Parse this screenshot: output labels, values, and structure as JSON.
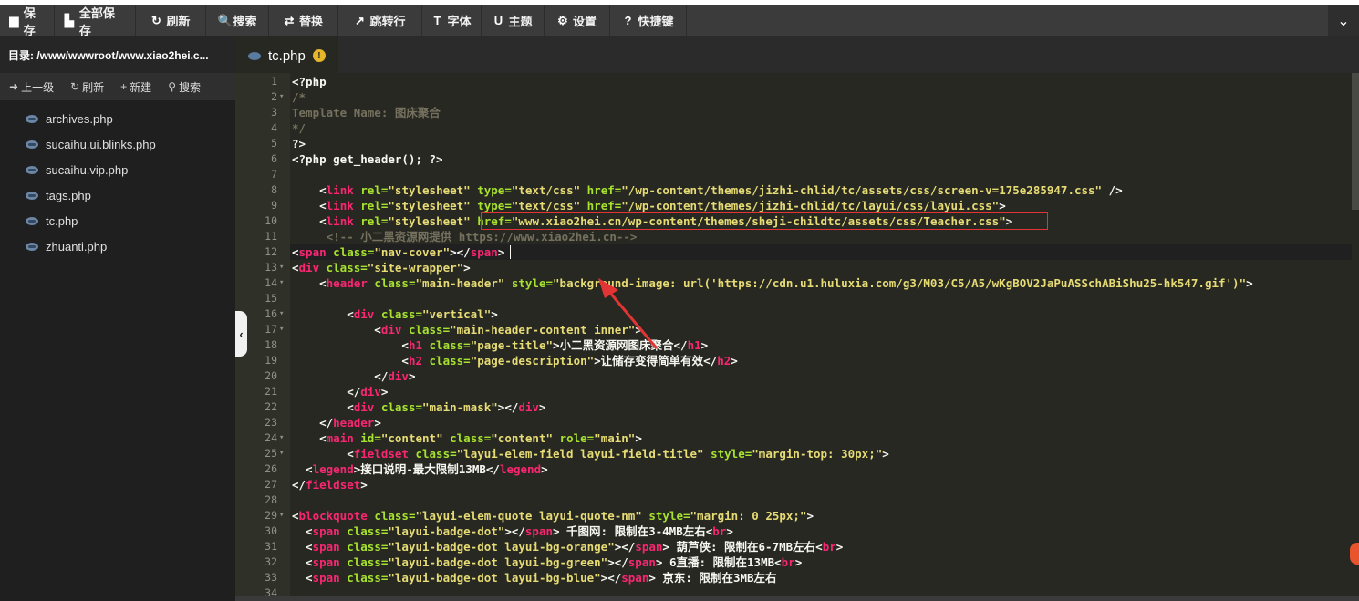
{
  "toolbar": {
    "buttons": [
      {
        "label": "保存",
        "icon": "floppy-disk-icon",
        "glyph": "▆"
      },
      {
        "label": "全部保存",
        "icon": "save-all-icon",
        "glyph": "▙"
      },
      {
        "label": "刷新",
        "icon": "refresh-icon",
        "glyph": "↻"
      },
      {
        "label": "搜索",
        "icon": "search-icon",
        "glyph": "🔍"
      },
      {
        "label": "替换",
        "icon": "replace-icon",
        "glyph": "⇄"
      },
      {
        "label": "跳转行",
        "icon": "goto-line-icon",
        "glyph": "↗"
      },
      {
        "label": "字体",
        "icon": "font-icon",
        "glyph": "T"
      },
      {
        "label": "主题",
        "icon": "theme-icon",
        "glyph": "U"
      },
      {
        "label": "设置",
        "icon": "gear-icon",
        "glyph": "⚙"
      },
      {
        "label": "快捷键",
        "icon": "help-icon",
        "glyph": "?"
      }
    ],
    "collapse_icon": "chevron-down-icon"
  },
  "sidebar": {
    "path": "目录: /www/wwwroot/www.xiao2hei.c...",
    "actions": [
      {
        "label": "上一级",
        "icon": "up-level-icon",
        "glyph": "➜"
      },
      {
        "label": "刷新",
        "icon": "refresh-icon",
        "glyph": "↻"
      },
      {
        "label": "新建",
        "icon": "plus-icon",
        "glyph": "+"
      },
      {
        "label": "搜索",
        "icon": "search-icon",
        "glyph": "⚲"
      }
    ],
    "files": [
      "archives.php",
      "sucaihu.ui.blinks.php",
      "sucaihu.vip.php",
      "tags.php",
      "tc.php",
      "zhuanti.php"
    ]
  },
  "editor": {
    "tab": {
      "label": "tc.php",
      "warning": "!"
    },
    "lines": [
      {
        "n": "1",
        "fold": "",
        "segs": [
          [
            "<?php",
            "#f8f8f2"
          ]
        ]
      },
      {
        "n": "2",
        "fold": "▾",
        "segs": [
          [
            "/*",
            "#75715e"
          ]
        ]
      },
      {
        "n": "3",
        "fold": "",
        "segs": [
          [
            "Template Name: 图床聚合",
            "#75715e"
          ]
        ]
      },
      {
        "n": "4",
        "fold": "",
        "segs": [
          [
            "*/",
            "#75715e"
          ]
        ]
      },
      {
        "n": "5",
        "fold": "",
        "segs": [
          [
            "?>",
            "#f8f8f2"
          ]
        ]
      },
      {
        "n": "6",
        "fold": "",
        "segs": [
          [
            "<?php get_header(); ?>",
            "#f8f8f2"
          ]
        ]
      },
      {
        "n": "7",
        "fold": "",
        "segs": []
      },
      {
        "n": "8",
        "fold": "",
        "segs": [
          [
            "    <",
            "#f8f8f2"
          ],
          [
            "link",
            "#f92672"
          ],
          [
            " rel=",
            "#a6e22e"
          ],
          [
            "\"stylesheet\"",
            "#e6db74"
          ],
          [
            " type=",
            "#a6e22e"
          ],
          [
            "\"text/css\"",
            "#e6db74"
          ],
          [
            " href=",
            "#a6e22e"
          ],
          [
            "\"/wp-content/themes/jizhi-chlid/tc/assets/css/screen-v=175e285947.css\"",
            "#e6db74"
          ],
          [
            " />",
            "#f8f8f2"
          ]
        ]
      },
      {
        "n": "9",
        "fold": "",
        "segs": [
          [
            "    <",
            "#f8f8f2"
          ],
          [
            "link",
            "#f92672"
          ],
          [
            " rel=",
            "#a6e22e"
          ],
          [
            "\"stylesheet\"",
            "#e6db74"
          ],
          [
            " type=",
            "#a6e22e"
          ],
          [
            "\"text/css\"",
            "#e6db74"
          ],
          [
            " href=",
            "#a6e22e"
          ],
          [
            "\"/wp-content/themes/jizhi-chlid/tc/layui/css/layui.css\"",
            "#e6db74"
          ],
          [
            ">",
            "#f8f8f2"
          ]
        ]
      },
      {
        "n": "10",
        "fold": "",
        "segs": [
          [
            "    <",
            "#f8f8f2"
          ],
          [
            "link",
            "#f92672"
          ],
          [
            " rel=",
            "#a6e22e"
          ],
          [
            "\"stylesheet\"",
            "#e6db74"
          ],
          [
            " ",
            "#f8f8f2"
          ],
          [
            "href=",
            "#a6e22e"
          ],
          [
            "\"www.xiao2hei.cn/wp-content/themes/sheji-childtc/assets/css/Teacher.css\"",
            "#e6db74"
          ],
          [
            ">",
            "#f8f8f2"
          ]
        ]
      },
      {
        "n": "11",
        "fold": "",
        "segs": [
          [
            "     <!-- 小二黑资源网提供 https://www.xiao2hei.cn-->",
            "#75715e"
          ]
        ]
      },
      {
        "n": "12",
        "fold": "",
        "segs": [
          [
            "<",
            "#f8f8f2"
          ],
          [
            "span",
            "#f92672"
          ],
          [
            " class=",
            "#a6e22e"
          ],
          [
            "\"nav-cover\"",
            "#e6db74"
          ],
          [
            "></",
            "#f8f8f2"
          ],
          [
            "span",
            "#f92672"
          ],
          [
            ">",
            "#f8f8f2"
          ]
        ]
      },
      {
        "n": "13",
        "fold": "▾",
        "segs": [
          [
            "<",
            "#f8f8f2"
          ],
          [
            "div",
            "#f92672"
          ],
          [
            " class=",
            "#a6e22e"
          ],
          [
            "\"site-wrapper\"",
            "#e6db74"
          ],
          [
            ">",
            "#f8f8f2"
          ]
        ]
      },
      {
        "n": "14",
        "fold": "▾",
        "segs": [
          [
            "    <",
            "#f8f8f2"
          ],
          [
            "header",
            "#f92672"
          ],
          [
            " class=",
            "#a6e22e"
          ],
          [
            "\"main-header\"",
            "#e6db74"
          ],
          [
            " style=",
            "#a6e22e"
          ],
          [
            "\"background-image: url('https://cdn.u1.huluxia.com/g3/M03/C5/A5/wKgBOV2JaPuASSchABiShu25-hk547.gif')\"",
            "#e6db74"
          ],
          [
            ">",
            "#f8f8f2"
          ]
        ]
      },
      {
        "n": "15",
        "fold": "",
        "segs": []
      },
      {
        "n": "16",
        "fold": "▾",
        "segs": [
          [
            "        <",
            "#f8f8f2"
          ],
          [
            "div",
            "#f92672"
          ],
          [
            " class=",
            "#a6e22e"
          ],
          [
            "\"vertical\"",
            "#e6db74"
          ],
          [
            ">",
            "#f8f8f2"
          ]
        ]
      },
      {
        "n": "17",
        "fold": "▾",
        "segs": [
          [
            "            <",
            "#f8f8f2"
          ],
          [
            "div",
            "#f92672"
          ],
          [
            " class=",
            "#a6e22e"
          ],
          [
            "\"main-header-content inner\"",
            "#e6db74"
          ],
          [
            ">",
            "#f8f8f2"
          ]
        ]
      },
      {
        "n": "18",
        "fold": "",
        "segs": [
          [
            "                <",
            "#f8f8f2"
          ],
          [
            "h1",
            "#f92672"
          ],
          [
            " class=",
            "#a6e22e"
          ],
          [
            "\"page-title\"",
            "#e6db74"
          ],
          [
            ">小二黑资源网图床聚合</",
            "#f8f8f2"
          ],
          [
            "h1",
            "#f92672"
          ],
          [
            ">",
            "#f8f8f2"
          ]
        ]
      },
      {
        "n": "19",
        "fold": "",
        "segs": [
          [
            "                <",
            "#f8f8f2"
          ],
          [
            "h2",
            "#f92672"
          ],
          [
            " class=",
            "#a6e22e"
          ],
          [
            "\"page-description\"",
            "#e6db74"
          ],
          [
            ">让储存变得简单有效</",
            "#f8f8f2"
          ],
          [
            "h2",
            "#f92672"
          ],
          [
            ">",
            "#f8f8f2"
          ]
        ]
      },
      {
        "n": "20",
        "fold": "",
        "segs": [
          [
            "            </",
            "#f8f8f2"
          ],
          [
            "div",
            "#f92672"
          ],
          [
            ">",
            "#f8f8f2"
          ]
        ]
      },
      {
        "n": "21",
        "fold": "",
        "segs": [
          [
            "        </",
            "#f8f8f2"
          ],
          [
            "div",
            "#f92672"
          ],
          [
            ">",
            "#f8f8f2"
          ]
        ]
      },
      {
        "n": "22",
        "fold": "",
        "segs": [
          [
            "        <",
            "#f8f8f2"
          ],
          [
            "div",
            "#f92672"
          ],
          [
            " class=",
            "#a6e22e"
          ],
          [
            "\"main-mask\"",
            "#e6db74"
          ],
          [
            "></",
            "#f8f8f2"
          ],
          [
            "div",
            "#f92672"
          ],
          [
            ">",
            "#f8f8f2"
          ]
        ]
      },
      {
        "n": "23",
        "fold": "",
        "segs": [
          [
            "    </",
            "#f8f8f2"
          ],
          [
            "header",
            "#f92672"
          ],
          [
            ">",
            "#f8f8f2"
          ]
        ]
      },
      {
        "n": "24",
        "fold": "▾",
        "segs": [
          [
            "    <",
            "#f8f8f2"
          ],
          [
            "main",
            "#f92672"
          ],
          [
            " id=",
            "#a6e22e"
          ],
          [
            "\"content\"",
            "#e6db74"
          ],
          [
            " class=",
            "#a6e22e"
          ],
          [
            "\"content\"",
            "#e6db74"
          ],
          [
            " role=",
            "#a6e22e"
          ],
          [
            "\"main\"",
            "#e6db74"
          ],
          [
            ">",
            "#f8f8f2"
          ]
        ]
      },
      {
        "n": "25",
        "fold": "▾",
        "segs": [
          [
            "        <",
            "#f8f8f2"
          ],
          [
            "fieldset",
            "#f92672"
          ],
          [
            " class=",
            "#a6e22e"
          ],
          [
            "\"layui-elem-field layui-field-title\"",
            "#e6db74"
          ],
          [
            " style=",
            "#a6e22e"
          ],
          [
            "\"margin-top: 30px;\"",
            "#e6db74"
          ],
          [
            ">",
            "#f8f8f2"
          ]
        ]
      },
      {
        "n": "26",
        "fold": "",
        "segs": [
          [
            "  <",
            "#f8f8f2"
          ],
          [
            "legend",
            "#f92672"
          ],
          [
            ">接口说明-最大限制13MB</",
            "#f8f8f2"
          ],
          [
            "legend",
            "#f92672"
          ],
          [
            ">",
            "#f8f8f2"
          ]
        ]
      },
      {
        "n": "27",
        "fold": "",
        "segs": [
          [
            "</",
            "#f8f8f2"
          ],
          [
            "fieldset",
            "#f92672"
          ],
          [
            ">",
            "#f8f8f2"
          ]
        ]
      },
      {
        "n": "28",
        "fold": "",
        "segs": []
      },
      {
        "n": "29",
        "fold": "▾",
        "segs": [
          [
            "<",
            "#f8f8f2"
          ],
          [
            "blockquote",
            "#f92672"
          ],
          [
            " class=",
            "#a6e22e"
          ],
          [
            "\"layui-elem-quote layui-quote-nm\"",
            "#e6db74"
          ],
          [
            " style=",
            "#a6e22e"
          ],
          [
            "\"margin: 0 25px;\"",
            "#e6db74"
          ],
          [
            ">",
            "#f8f8f2"
          ]
        ]
      },
      {
        "n": "30",
        "fold": "",
        "segs": [
          [
            "  <",
            "#f8f8f2"
          ],
          [
            "span",
            "#f92672"
          ],
          [
            " class=",
            "#a6e22e"
          ],
          [
            "\"layui-badge-dot\"",
            "#e6db74"
          ],
          [
            "></",
            "#f8f8f2"
          ],
          [
            "span",
            "#f92672"
          ],
          [
            "> 千图网: 限制在3-4MB左右<",
            "#f8f8f2"
          ],
          [
            "br",
            "#f92672"
          ],
          [
            ">",
            "#f8f8f2"
          ]
        ]
      },
      {
        "n": "31",
        "fold": "",
        "segs": [
          [
            "  <",
            "#f8f8f2"
          ],
          [
            "span",
            "#f92672"
          ],
          [
            " class=",
            "#a6e22e"
          ],
          [
            "\"layui-badge-dot layui-bg-orange\"",
            "#e6db74"
          ],
          [
            "></",
            "#f8f8f2"
          ],
          [
            "span",
            "#f92672"
          ],
          [
            "> 葫芦侠: 限制在6-7MB左右<",
            "#f8f8f2"
          ],
          [
            "br",
            "#f92672"
          ],
          [
            ">",
            "#f8f8f2"
          ]
        ]
      },
      {
        "n": "32",
        "fold": "",
        "segs": [
          [
            "  <",
            "#f8f8f2"
          ],
          [
            "span",
            "#f92672"
          ],
          [
            " class=",
            "#a6e22e"
          ],
          [
            "\"layui-badge-dot layui-bg-green\"",
            "#e6db74"
          ],
          [
            "></",
            "#f8f8f2"
          ],
          [
            "span",
            "#f92672"
          ],
          [
            "> 6直播: 限制在13MB<",
            "#f8f8f2"
          ],
          [
            "br",
            "#f92672"
          ],
          [
            ">",
            "#f8f8f2"
          ]
        ]
      },
      {
        "n": "33",
        "fold": "",
        "segs": [
          [
            "  <",
            "#f8f8f2"
          ],
          [
            "span",
            "#f92672"
          ],
          [
            " class=",
            "#a6e22e"
          ],
          [
            "\"layui-badge-dot layui-bg-blue\"",
            "#e6db74"
          ],
          [
            "></",
            "#f8f8f2"
          ],
          [
            "span",
            "#f92672"
          ],
          [
            "> 京东: 限制在3MB左右",
            "#f8f8f2"
          ]
        ]
      },
      {
        "n": "34",
        "fold": "",
        "segs": []
      }
    ]
  },
  "colors": {
    "toolbar_bg": "#3b3b3b",
    "editor_bg": "#272822",
    "tag": "#f92672",
    "attr": "#a6e22e",
    "string": "#e6db74",
    "comment": "#75715e",
    "annotation": "#e23434"
  }
}
